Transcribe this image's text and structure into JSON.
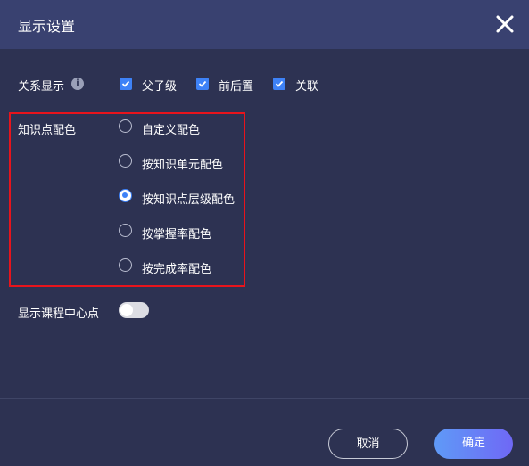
{
  "dialog": {
    "title": "显示设置",
    "close_icon": "close-icon"
  },
  "relation": {
    "label": "关系显示",
    "info_icon": "info-icon",
    "options": [
      {
        "label": "父子级",
        "checked": true
      },
      {
        "label": "前后置",
        "checked": true
      },
      {
        "label": "关联",
        "checked": true
      }
    ]
  },
  "coloring": {
    "label": "知识点配色",
    "options": [
      {
        "label": "自定义配色",
        "selected": false
      },
      {
        "label": "按知识单元配色",
        "selected": false
      },
      {
        "label": "按知识点层级配色",
        "selected": true
      },
      {
        "label": "按掌握率配色",
        "selected": false
      },
      {
        "label": "按完成率配色",
        "selected": false
      }
    ],
    "highlight_color": "#e8141c"
  },
  "center": {
    "label": "显示课程中心点",
    "enabled": false
  },
  "footer": {
    "cancel_label": "取消",
    "ok_label": "确定"
  },
  "colors": {
    "accent": "#3e82f7",
    "header_bg": "#394170",
    "body_bg": "#2d3252"
  }
}
